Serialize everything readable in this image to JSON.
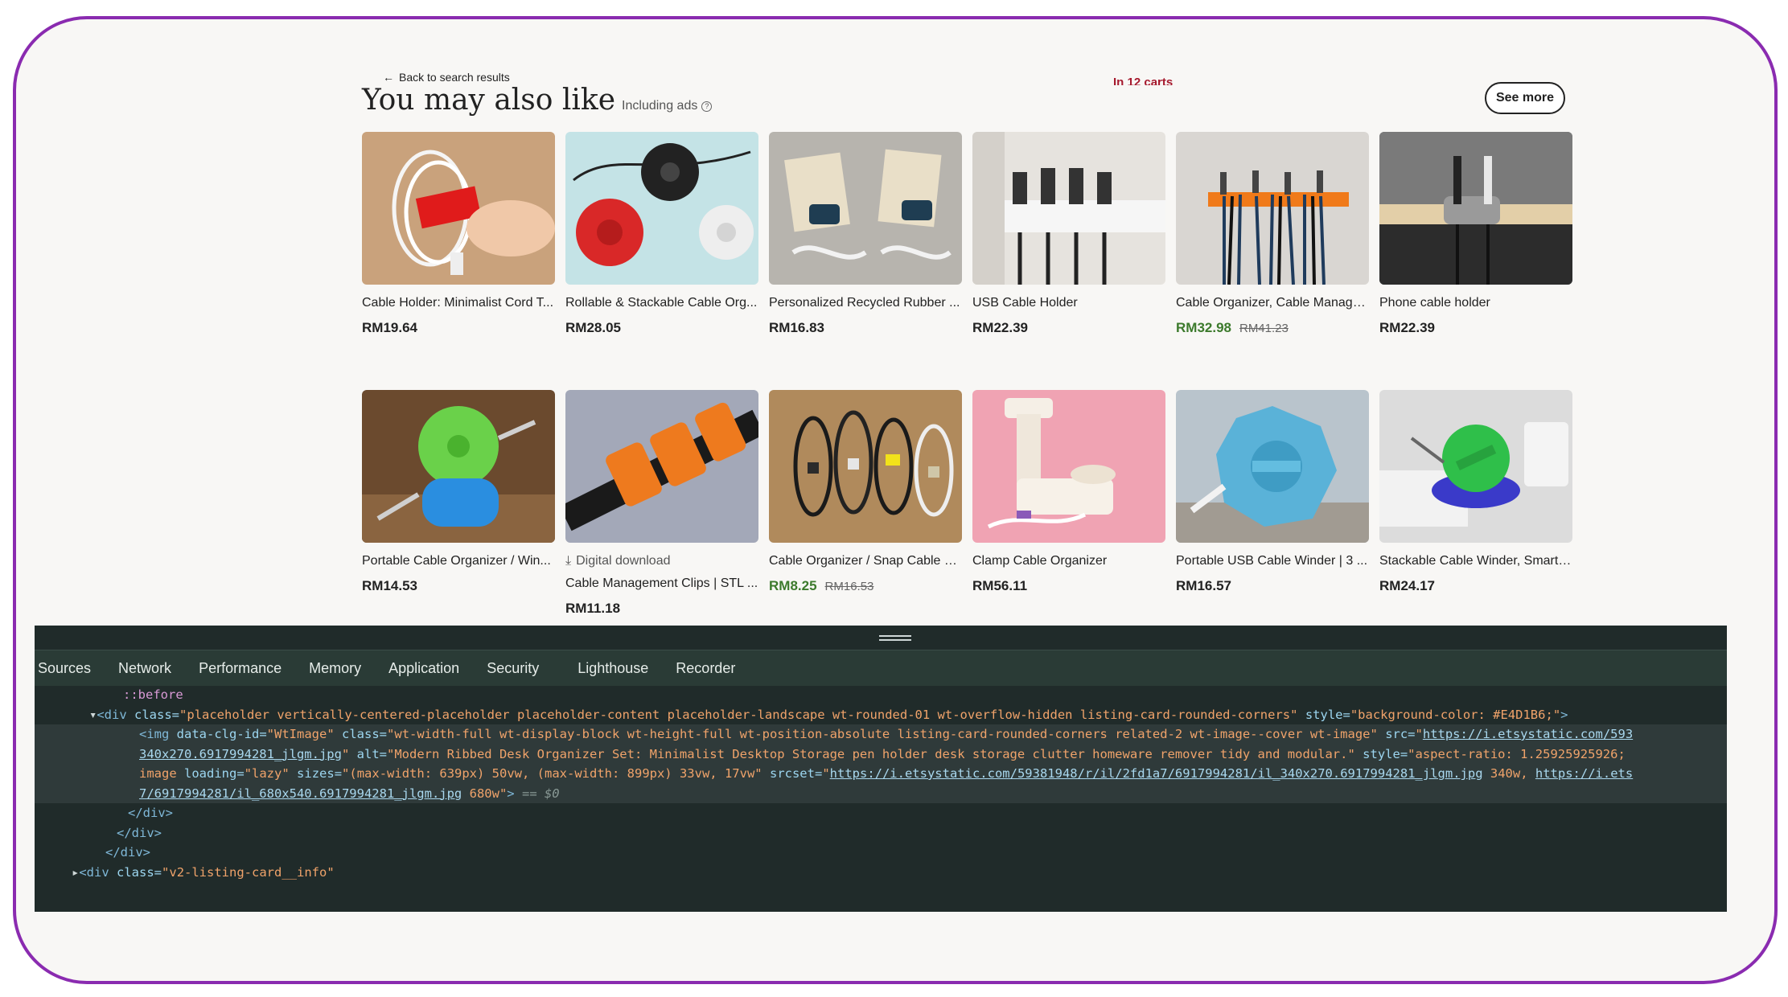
{
  "page": {
    "back_link": "Back to search results",
    "in_carts": "In 12 carts",
    "heading": "You may also like",
    "ads_label": "Including ads",
    "see_more": "See more"
  },
  "row1": [
    {
      "title": "Cable Holder: Minimalist Cord T...",
      "price": "RM19.64"
    },
    {
      "title": "Rollable & Stackable Cable Org...",
      "price": "RM28.05"
    },
    {
      "title": "Personalized Recycled Rubber ...",
      "price": "RM16.83"
    },
    {
      "title": "USB Cable Holder",
      "price": "RM22.39"
    },
    {
      "title": "Cable Organizer, Cable Manage...",
      "price": "RM32.98",
      "original_price": "RM41.23"
    },
    {
      "title": "Phone cable holder",
      "price": "RM22.39"
    }
  ],
  "row2": [
    {
      "title": "Portable Cable Organizer / Win...",
      "price": "RM14.53"
    },
    {
      "badge": "Digital download",
      "title": "Cable Management Clips | STL ...",
      "price": "RM11.18"
    },
    {
      "title": "Cable Organizer / Snap Cable C...",
      "price": "RM8.25",
      "original_price": "RM16.53"
    },
    {
      "title": "Clamp Cable Organizer",
      "price": "RM56.11"
    },
    {
      "title": "Portable USB Cable Winder | 3 ...",
      "price": "RM16.57"
    },
    {
      "title": "Stackable Cable Winder, Smart ...",
      "price": "RM24.17"
    }
  ],
  "devtools": {
    "tabs": [
      "Sources",
      "Network",
      "Performance",
      "Memory",
      "Application",
      "Security",
      "Lighthouse",
      "Recorder"
    ],
    "lines": {
      "before": "::before",
      "div_class": "placeholder vertically-centered-placeholder placeholder-content placeholder-landscape wt-rounded-01 wt-overflow-hidden listing-card-rounded-corners",
      "div_style": "background-color: #E4D1B6;",
      "img_clg": "WtImage",
      "img_class": "wt-width-full wt-display-block wt-height-full wt-position-absolute listing-card-rounded-corners related-2 wt-image--cover wt-image",
      "img_src_a": "https://i.etsystatic.com/593",
      "img_src_b": "340x270.6917994281_jlgm.jpg",
      "img_alt": "Modern Ribbed Desk Organizer Set: Minimalist Desktop Storage pen holder desk storage clutter homeware remover tidy and modular.",
      "img_style_a": "aspect-ratio: 1.25925925926;",
      "img_style_b": "image",
      "img_loading": "lazy",
      "img_sizes": "(max-width: 639px) 50vw, (max-width: 899px) 33vw, 17vw",
      "img_srcset_a": "https://i.etsystatic.com/59381948/r/il/2fd1a7/6917994281/il_340x270.6917994281_jlgm.jpg",
      "img_srcset_b": "340w,",
      "img_srcset_c": "https://i.ets",
      "img_srcset_d": "7/6917994281/il_680x540.6917994281_jlgm.jpg",
      "img_srcset_e": "680w",
      "eq": "== $0",
      "close_div": "</div>",
      "info_class": "v2-listing-card__info"
    }
  },
  "colors": {
    "frame_border": "#8a2bb0",
    "sale_price": "#3c7a2c",
    "in_carts": "#a61a2e",
    "devtools_bg": "#202b2a"
  }
}
